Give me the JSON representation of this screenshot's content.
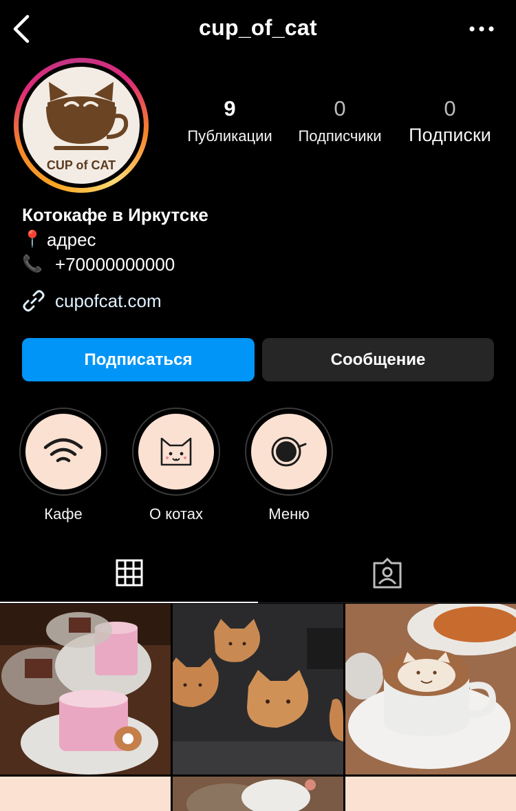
{
  "header": {
    "username": "cup_of_cat",
    "back_icon": "chevron-left-icon",
    "more_icon": "more-horizontal-icon"
  },
  "profile": {
    "avatar_text": "CUP of CAT",
    "stats": [
      {
        "value": "9",
        "label": "Публикации"
      },
      {
        "value": "0",
        "label": "Подписчики"
      },
      {
        "value": "0",
        "label": "Подписки"
      }
    ],
    "bio": {
      "name": "Котокафе в Иркутске",
      "address_emoji": "📍",
      "address": "адрес",
      "phone_emoji": "📞",
      "phone": "+70000000000",
      "link": "cupofcat.com"
    }
  },
  "actions": {
    "follow_label": "Подписаться",
    "message_label": "Сообщение"
  },
  "highlights": [
    {
      "label": "Кафе",
      "icon": "wifi-icon"
    },
    {
      "label": "О котах",
      "icon": "cat-face-icon"
    },
    {
      "label": "Меню",
      "icon": "coffee-cup-icon"
    }
  ],
  "tabs": [
    {
      "icon": "grid-icon",
      "active": true
    },
    {
      "icon": "tagged-person-icon",
      "active": false
    }
  ],
  "colors": {
    "accent": "#0095f6",
    "highlight_bg": "#fbe1d2",
    "logo_brown": "#6b4423"
  }
}
